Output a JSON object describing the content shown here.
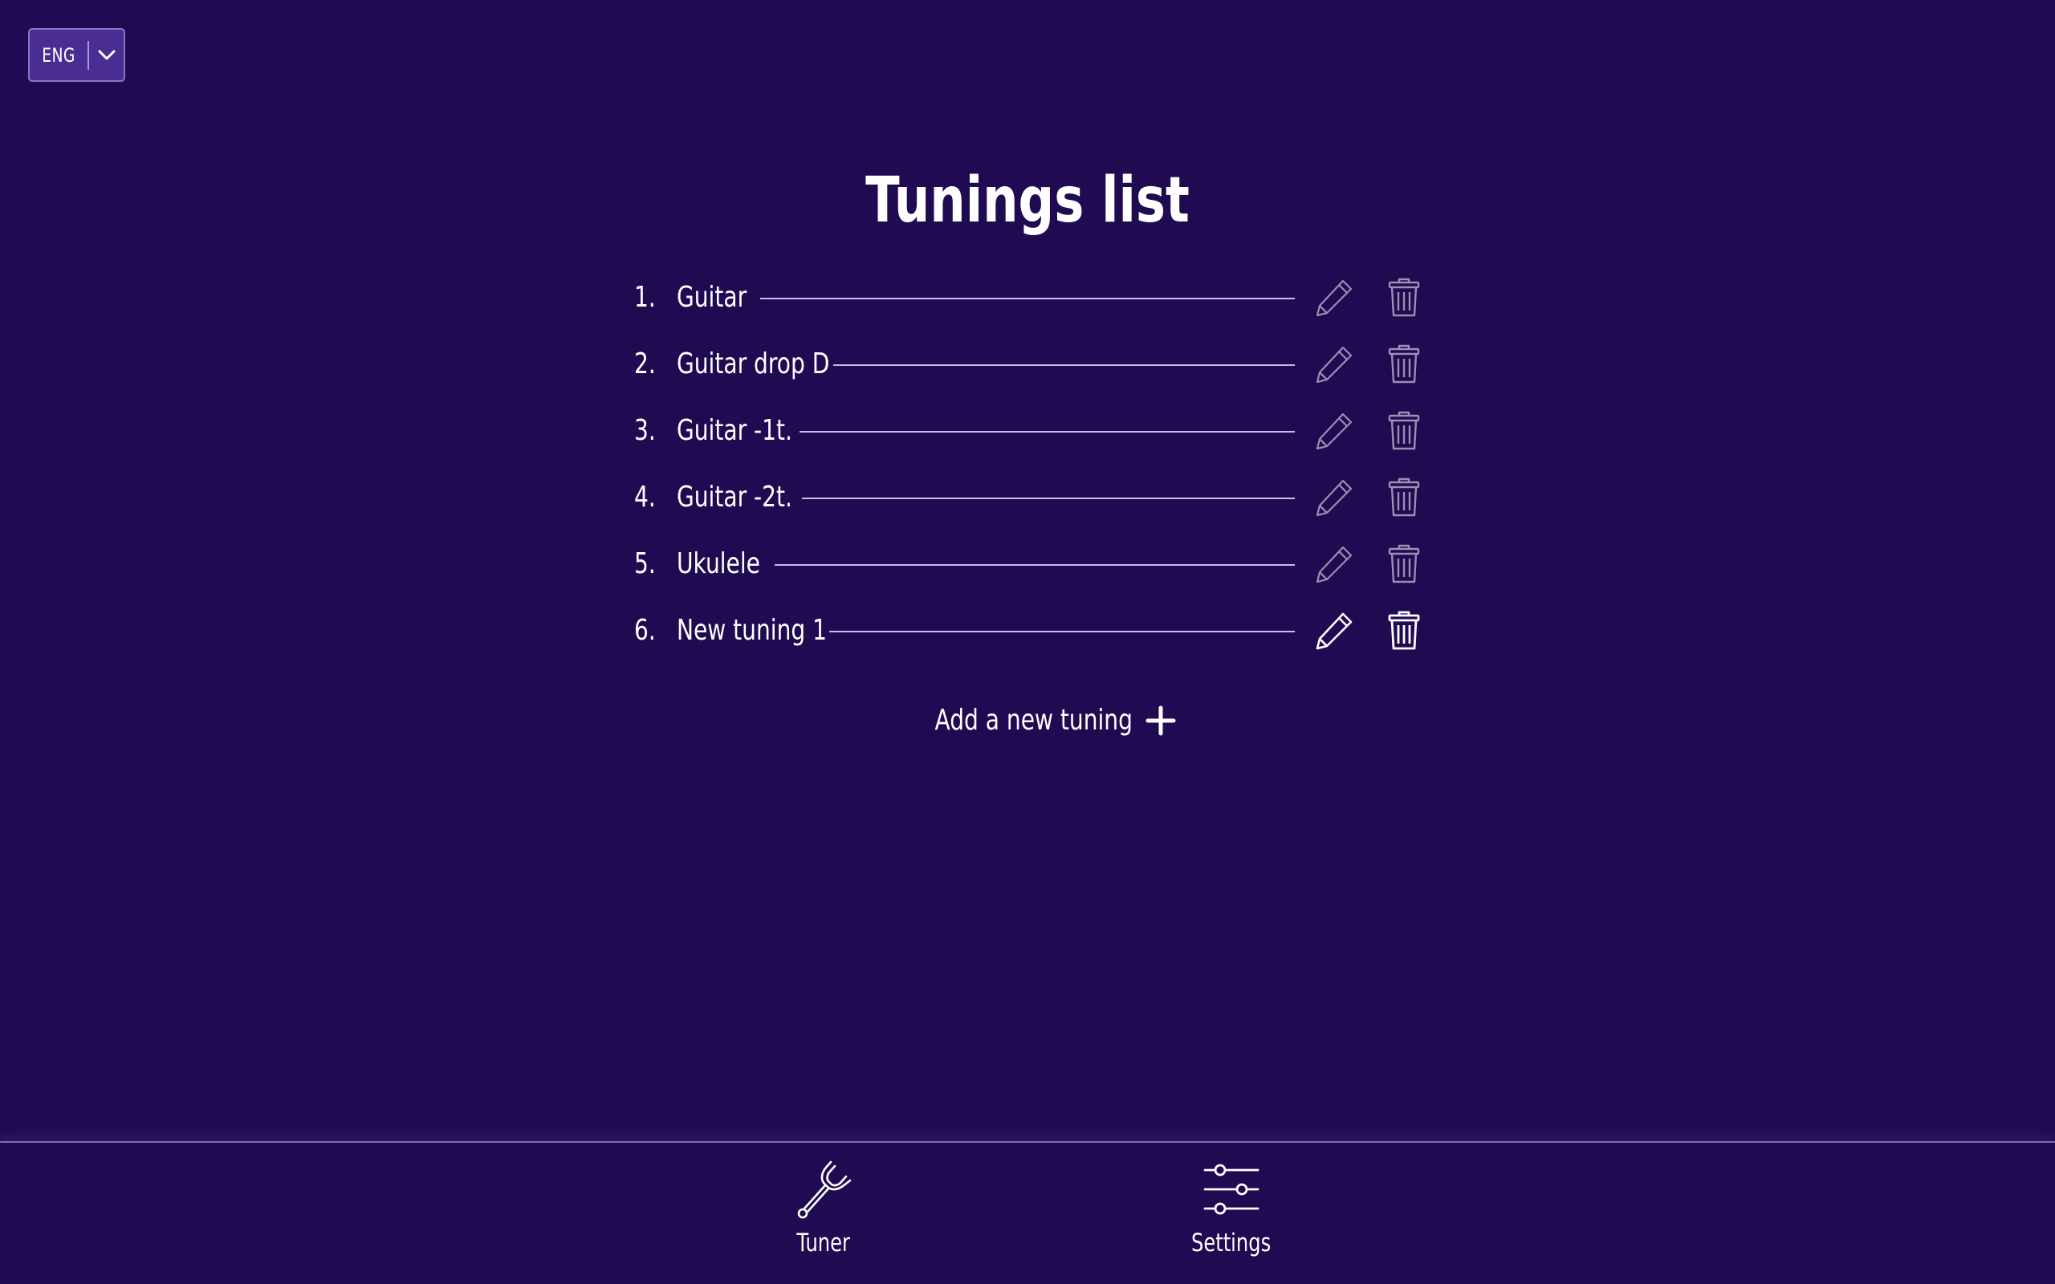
{
  "language": {
    "selected": "ENG"
  },
  "page": {
    "title": "Tunings list"
  },
  "tunings": [
    {
      "number": "1.",
      "name": "Guitar"
    },
    {
      "number": "2.",
      "name": "Guitar drop D"
    },
    {
      "number": "3.",
      "name": "Guitar -1t."
    },
    {
      "number": "4.",
      "name": "Guitar -2t."
    },
    {
      "number": "5.",
      "name": "Ukulele"
    },
    {
      "number": "6.",
      "name": "New tuning 1"
    }
  ],
  "add": {
    "label": "Add a new tuning",
    "icon": "plus-icon"
  },
  "nav": {
    "tuner": {
      "label": "Tuner",
      "icon": "tuning-fork-icon"
    },
    "settings": {
      "label": "Settings",
      "icon": "sliders-icon"
    }
  },
  "colors": {
    "background": "#200a52",
    "accent": "#4a2d92",
    "text": "#ffffff"
  }
}
